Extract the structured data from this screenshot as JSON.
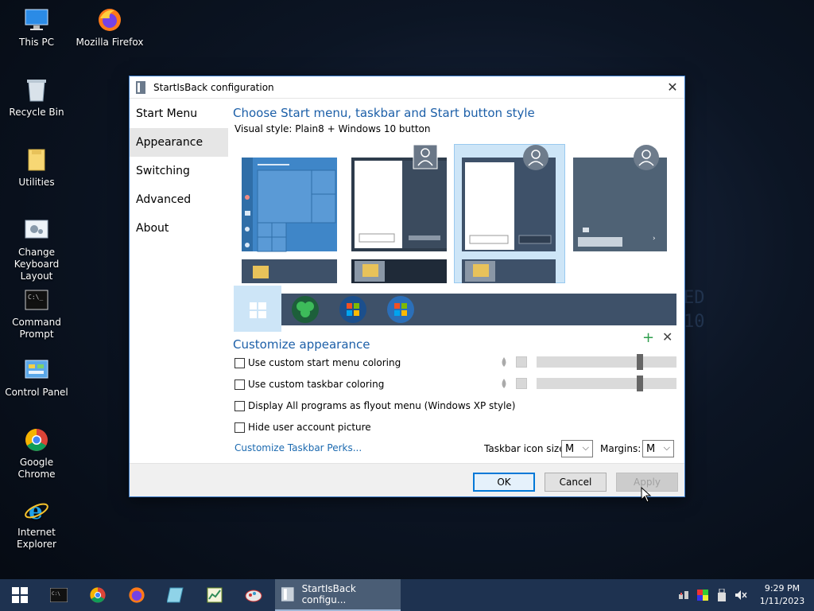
{
  "desktop": {
    "icons": [
      {
        "label": "This PC"
      },
      {
        "label": "Mozilla Firefox"
      },
      {
        "label": "Recycle Bin"
      },
      {
        "label": "Utilities"
      },
      {
        "label": "Change Keyboard Layout"
      },
      {
        "label": "Command Prompt"
      },
      {
        "label": "Control Panel"
      },
      {
        "label": "Google Chrome"
      },
      {
        "label": "Internet Explorer"
      }
    ]
  },
  "dialog": {
    "title": "StartIsBack configuration",
    "nav": [
      "Start Menu",
      "Appearance",
      "Switching",
      "Advanced",
      "About"
    ],
    "active_nav": "Appearance",
    "section_title": "Choose Start menu, taskbar and Start button style",
    "visual_style": "Visual style:  Plain8 + Windows 10 button",
    "customize_title": "Customize appearance",
    "options": [
      {
        "label": "Use custom start menu coloring",
        "checked": false
      },
      {
        "label": "Use custom taskbar coloring",
        "checked": false
      },
      {
        "label": "Display All programs as flyout menu (Windows XP style)",
        "checked": false
      },
      {
        "label": "Hide user account picture",
        "checked": false
      }
    ],
    "link": "Customize Taskbar Perks...",
    "taskbar_icon_size_label": "Taskbar icon size:",
    "taskbar_icon_size_value": "M",
    "margins_label": "Margins:",
    "margins_value": "M",
    "buttons": {
      "ok": "OK",
      "cancel": "Cancel",
      "apply": "Apply"
    }
  },
  "taskbar": {
    "active_task": "StartIsBack configu...",
    "time": "9:29 PM",
    "date": "1/11/2023"
  },
  "colors": {
    "accent": "#1c5fa8",
    "selection": "#cde5f7",
    "taskbar": "#1e3250"
  }
}
